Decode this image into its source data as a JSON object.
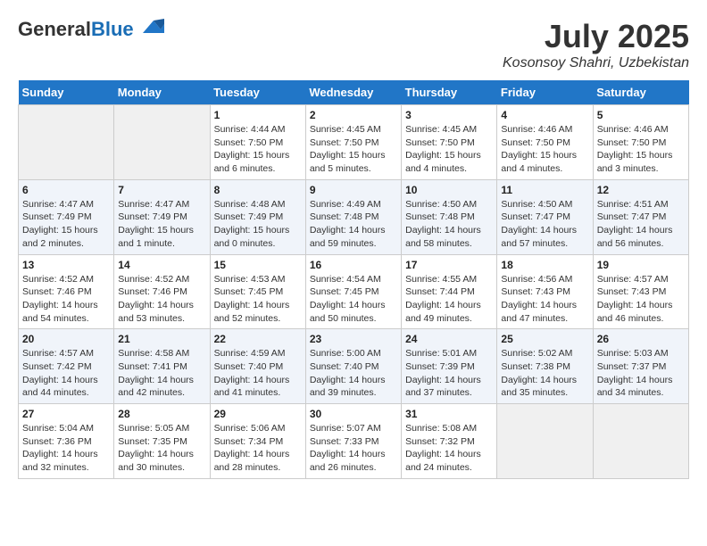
{
  "header": {
    "logo_general": "General",
    "logo_blue": "Blue",
    "month_year": "July 2025",
    "location": "Kosonsoy Shahri, Uzbekistan"
  },
  "weekdays": [
    "Sunday",
    "Monday",
    "Tuesday",
    "Wednesday",
    "Thursday",
    "Friday",
    "Saturday"
  ],
  "weeks": [
    [
      {
        "day": "",
        "info": ""
      },
      {
        "day": "",
        "info": ""
      },
      {
        "day": "1",
        "info": "Sunrise: 4:44 AM\nSunset: 7:50 PM\nDaylight: 15 hours\nand 6 minutes."
      },
      {
        "day": "2",
        "info": "Sunrise: 4:45 AM\nSunset: 7:50 PM\nDaylight: 15 hours\nand 5 minutes."
      },
      {
        "day": "3",
        "info": "Sunrise: 4:45 AM\nSunset: 7:50 PM\nDaylight: 15 hours\nand 4 minutes."
      },
      {
        "day": "4",
        "info": "Sunrise: 4:46 AM\nSunset: 7:50 PM\nDaylight: 15 hours\nand 4 minutes."
      },
      {
        "day": "5",
        "info": "Sunrise: 4:46 AM\nSunset: 7:50 PM\nDaylight: 15 hours\nand 3 minutes."
      }
    ],
    [
      {
        "day": "6",
        "info": "Sunrise: 4:47 AM\nSunset: 7:49 PM\nDaylight: 15 hours\nand 2 minutes."
      },
      {
        "day": "7",
        "info": "Sunrise: 4:47 AM\nSunset: 7:49 PM\nDaylight: 15 hours\nand 1 minute."
      },
      {
        "day": "8",
        "info": "Sunrise: 4:48 AM\nSunset: 7:49 PM\nDaylight: 15 hours\nand 0 minutes."
      },
      {
        "day": "9",
        "info": "Sunrise: 4:49 AM\nSunset: 7:48 PM\nDaylight: 14 hours\nand 59 minutes."
      },
      {
        "day": "10",
        "info": "Sunrise: 4:50 AM\nSunset: 7:48 PM\nDaylight: 14 hours\nand 58 minutes."
      },
      {
        "day": "11",
        "info": "Sunrise: 4:50 AM\nSunset: 7:47 PM\nDaylight: 14 hours\nand 57 minutes."
      },
      {
        "day": "12",
        "info": "Sunrise: 4:51 AM\nSunset: 7:47 PM\nDaylight: 14 hours\nand 56 minutes."
      }
    ],
    [
      {
        "day": "13",
        "info": "Sunrise: 4:52 AM\nSunset: 7:46 PM\nDaylight: 14 hours\nand 54 minutes."
      },
      {
        "day": "14",
        "info": "Sunrise: 4:52 AM\nSunset: 7:46 PM\nDaylight: 14 hours\nand 53 minutes."
      },
      {
        "day": "15",
        "info": "Sunrise: 4:53 AM\nSunset: 7:45 PM\nDaylight: 14 hours\nand 52 minutes."
      },
      {
        "day": "16",
        "info": "Sunrise: 4:54 AM\nSunset: 7:45 PM\nDaylight: 14 hours\nand 50 minutes."
      },
      {
        "day": "17",
        "info": "Sunrise: 4:55 AM\nSunset: 7:44 PM\nDaylight: 14 hours\nand 49 minutes."
      },
      {
        "day": "18",
        "info": "Sunrise: 4:56 AM\nSunset: 7:43 PM\nDaylight: 14 hours\nand 47 minutes."
      },
      {
        "day": "19",
        "info": "Sunrise: 4:57 AM\nSunset: 7:43 PM\nDaylight: 14 hours\nand 46 minutes."
      }
    ],
    [
      {
        "day": "20",
        "info": "Sunrise: 4:57 AM\nSunset: 7:42 PM\nDaylight: 14 hours\nand 44 minutes."
      },
      {
        "day": "21",
        "info": "Sunrise: 4:58 AM\nSunset: 7:41 PM\nDaylight: 14 hours\nand 42 minutes."
      },
      {
        "day": "22",
        "info": "Sunrise: 4:59 AM\nSunset: 7:40 PM\nDaylight: 14 hours\nand 41 minutes."
      },
      {
        "day": "23",
        "info": "Sunrise: 5:00 AM\nSunset: 7:40 PM\nDaylight: 14 hours\nand 39 minutes."
      },
      {
        "day": "24",
        "info": "Sunrise: 5:01 AM\nSunset: 7:39 PM\nDaylight: 14 hours\nand 37 minutes."
      },
      {
        "day": "25",
        "info": "Sunrise: 5:02 AM\nSunset: 7:38 PM\nDaylight: 14 hours\nand 35 minutes."
      },
      {
        "day": "26",
        "info": "Sunrise: 5:03 AM\nSunset: 7:37 PM\nDaylight: 14 hours\nand 34 minutes."
      }
    ],
    [
      {
        "day": "27",
        "info": "Sunrise: 5:04 AM\nSunset: 7:36 PM\nDaylight: 14 hours\nand 32 minutes."
      },
      {
        "day": "28",
        "info": "Sunrise: 5:05 AM\nSunset: 7:35 PM\nDaylight: 14 hours\nand 30 minutes."
      },
      {
        "day": "29",
        "info": "Sunrise: 5:06 AM\nSunset: 7:34 PM\nDaylight: 14 hours\nand 28 minutes."
      },
      {
        "day": "30",
        "info": "Sunrise: 5:07 AM\nSunset: 7:33 PM\nDaylight: 14 hours\nand 26 minutes."
      },
      {
        "day": "31",
        "info": "Sunrise: 5:08 AM\nSunset: 7:32 PM\nDaylight: 14 hours\nand 24 minutes."
      },
      {
        "day": "",
        "info": ""
      },
      {
        "day": "",
        "info": ""
      }
    ]
  ]
}
